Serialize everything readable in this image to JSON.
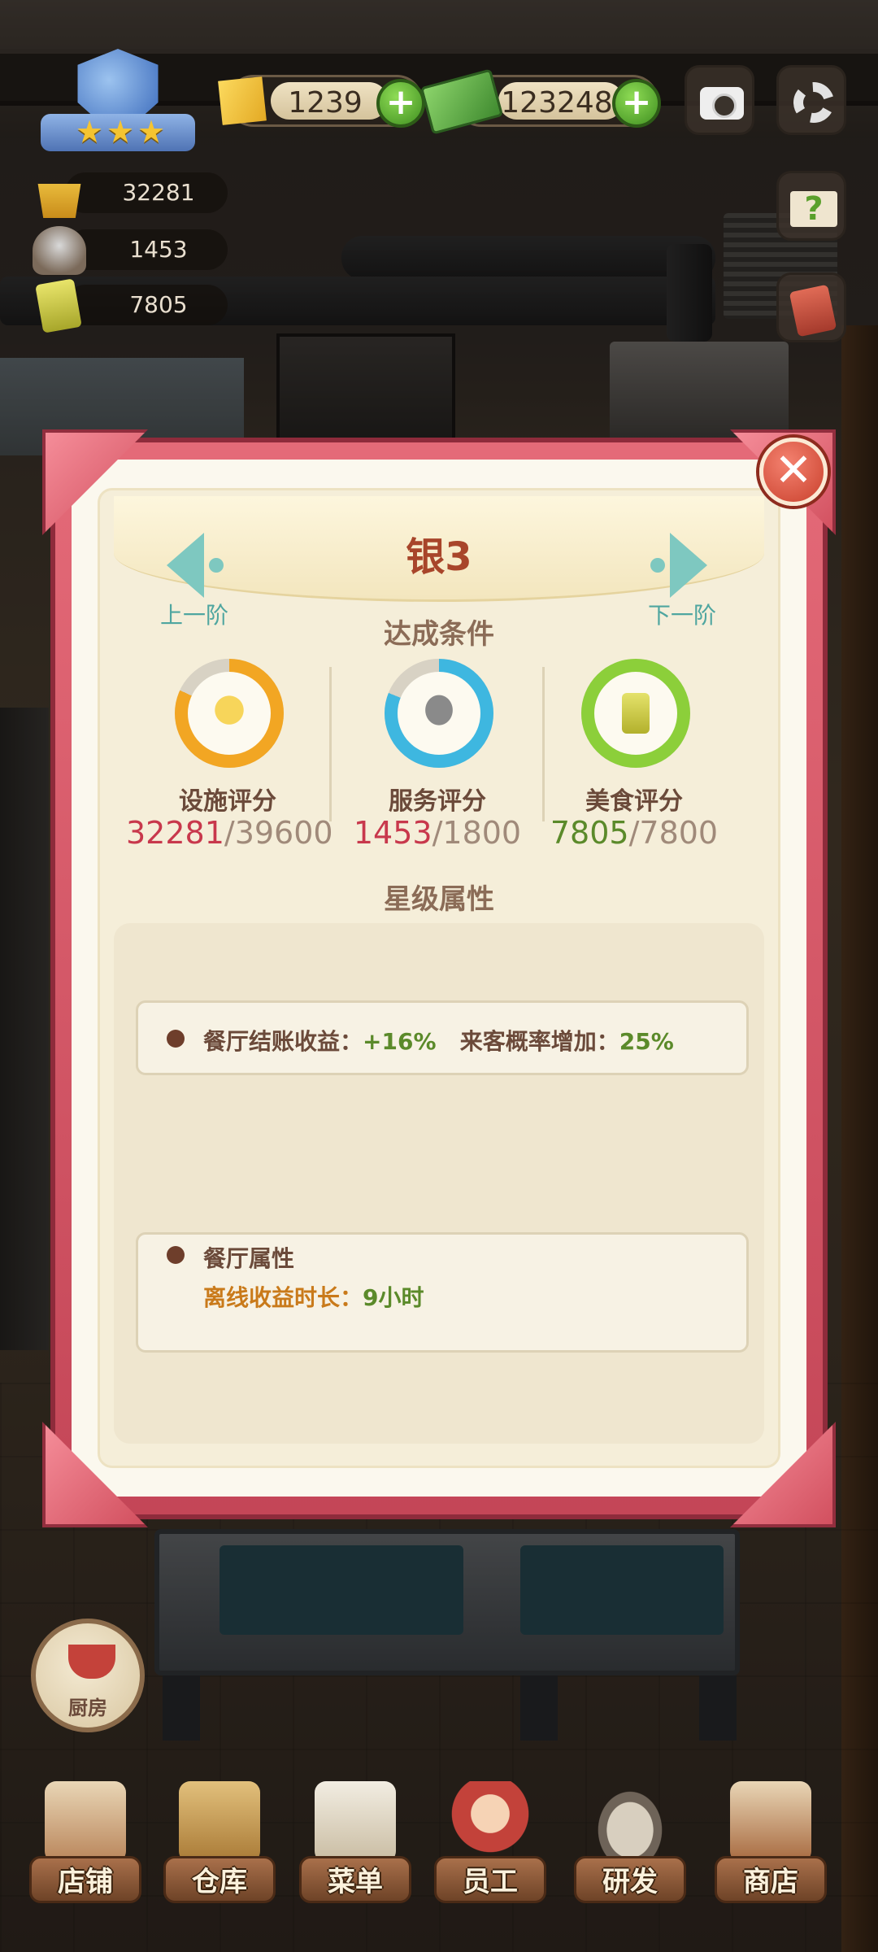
{
  "hud": {
    "gems": "1239",
    "cash": "123248",
    "stats": {
      "facility": "32281",
      "service": "1453",
      "food": "7805"
    }
  },
  "modal": {
    "title": "银3",
    "prev_label": "上一阶",
    "next_label": "下一阶",
    "conditions_title": "达成条件",
    "scores": [
      {
        "name": "设施评分",
        "current": "32281",
        "target": "39600",
        "current_color": "#c8384c",
        "ring_color": "#f2a623",
        "progress": 0.82
      },
      {
        "name": "服务评分",
        "current": "1453",
        "target": "1800",
        "current_color": "#c8384c",
        "ring_color": "#3eb7e0",
        "progress": 0.81
      },
      {
        "name": "美食评分",
        "current": "7805",
        "target": "7800",
        "current_color": "#5b8a2a",
        "ring_color": "#8ccf3a",
        "progress": 1.0
      }
    ],
    "attributes_title": "星级属性",
    "income_label": "餐厅结账收益：",
    "income_value": "+16%",
    "visit_label": "来客概率增加：",
    "visit_value": "25%",
    "restaurant_props_title": "餐厅属性",
    "offline_label": "离线收益时长：",
    "offline_value": "9小时"
  },
  "kitchen_label": "厨房",
  "nav": [
    {
      "label": "店铺",
      "icon": "shop-icon"
    },
    {
      "label": "仓库",
      "icon": "warehouse-icon"
    },
    {
      "label": "菜单",
      "icon": "menu-icon"
    },
    {
      "label": "员工",
      "icon": "staff-icon"
    },
    {
      "label": "研发",
      "icon": "research-icon"
    },
    {
      "label": "商店",
      "icon": "store-icon"
    }
  ],
  "colors": {
    "frame": "#e46a78",
    "accent_teal": "#7ec8c0",
    "title_brown": "#a8452a"
  }
}
